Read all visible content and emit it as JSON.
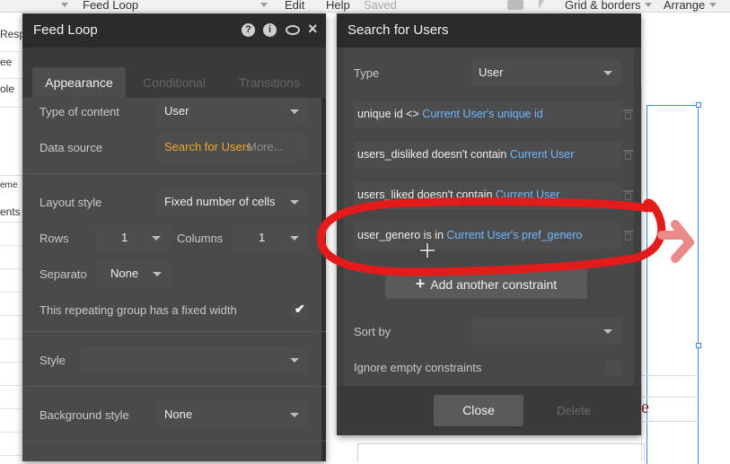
{
  "topbar": {
    "items": [
      "Feed Loop",
      "Edit",
      "Help",
      "Saved",
      "Grid & borders",
      "Arrange"
    ]
  },
  "left_strip": {
    "fragments": [
      "Resp",
      "ee",
      "ole",
      "eme",
      "ents"
    ]
  },
  "feed_panel": {
    "title": "Feed Loop",
    "tabs": [
      "Appearance",
      "Conditional",
      "Transitions"
    ],
    "type_of_content": {
      "label": "Type of content",
      "value": "User"
    },
    "data_source": {
      "label": "Data source",
      "value": "Search for Users",
      "more": "More..."
    },
    "layout_style": {
      "label": "Layout style",
      "value": "Fixed number of cells"
    },
    "rows": {
      "label": "Rows",
      "value": "1"
    },
    "columns": {
      "label": "Columns",
      "value": "1"
    },
    "separator": {
      "label": "Separato",
      "value": "None"
    },
    "fixed_width": {
      "label": "This repeating group has a fixed width",
      "checked": true
    },
    "style": {
      "label": "Style",
      "value": ""
    },
    "background_style": {
      "label": "Background style",
      "value": "None"
    }
  },
  "search_panel": {
    "title": "Search for Users",
    "type": {
      "label": "Type",
      "value": "User"
    },
    "constraints": [
      {
        "field": "unique id <>",
        "value": "Current User's unique id"
      },
      {
        "field": "users_disliked doesn't contain",
        "value": "Current User"
      },
      {
        "field": "users_liked doesn't contain",
        "value": "Current User"
      },
      {
        "field": "user_genero is in",
        "value": "Current User's pref_genero"
      }
    ],
    "add_constraint": "Add another constraint",
    "sort_by": {
      "label": "Sort by",
      "value": ""
    },
    "ignore_empty": {
      "label": "Ignore empty constraints",
      "checked": false
    },
    "close": "Close",
    "delete": "Delete"
  },
  "colors": {
    "panel_bg": "#3f3f3f",
    "title_bg": "#2b2b2b",
    "link_blue": "#6fb7ff",
    "data_source_orange": "#f0a830",
    "annotation_red": "#e31b1b"
  }
}
